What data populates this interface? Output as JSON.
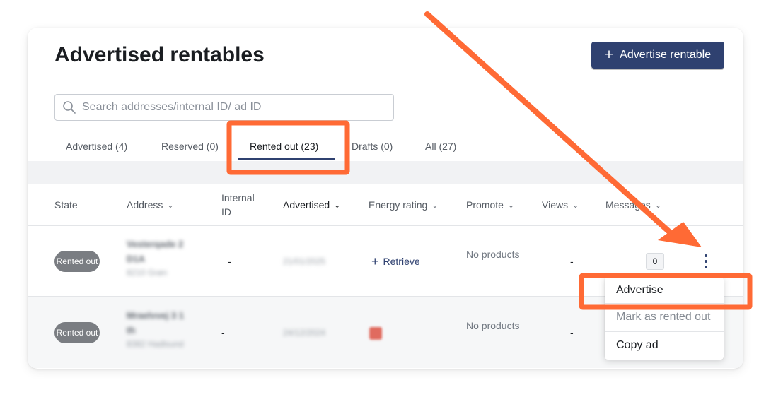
{
  "header": {
    "title": "Advertised rentables",
    "advertise_button": "Advertise rentable"
  },
  "search": {
    "placeholder": "Search addresses/internal ID/ ad ID"
  },
  "tabs": [
    {
      "label": "Advertised (4)",
      "active": false
    },
    {
      "label": "Reserved (0)",
      "active": false
    },
    {
      "label": "Rented out (23)",
      "active": true
    },
    {
      "label": "Drafts (0)",
      "active": false
    },
    {
      "label": "All (27)",
      "active": false
    }
  ],
  "table": {
    "columns": {
      "state": "State",
      "address": "Address",
      "internal_id": "Internal ID",
      "advertised": "Advertised",
      "energy_rating": "Energy rating",
      "promote": "Promote",
      "views": "Views",
      "messages": "Messages"
    },
    "rows": [
      {
        "state": "Rented out",
        "address_line1": "Vesterqade 2",
        "address_line2": "D1A",
        "address_line3": "8210 Grøn",
        "internal_id": "-",
        "advertised": "21/01/2025",
        "energy_action": "Retrieve",
        "promote": "No products",
        "views": "-",
        "messages": "0"
      },
      {
        "state": "Rented out",
        "address_line1": "Mraelvvej 3 1",
        "address_line2": "th",
        "address_line3": "8382 Hadlsund",
        "internal_id": "-",
        "advertised": "24/12/2024",
        "energy_action": "",
        "promote": "No products",
        "views": "-",
        "messages": ""
      }
    ]
  },
  "context_menu": {
    "items": [
      {
        "label": "Advertise",
        "enabled": true
      },
      {
        "label": "Mark as rented out",
        "enabled": false
      },
      {
        "label": "Copy ad",
        "enabled": true
      }
    ]
  },
  "colors": {
    "primary": "#2f4170",
    "annotation": "#ff6a35",
    "pill": "#7a7d82"
  },
  "icons": [
    "plus-icon",
    "search-icon",
    "chevron-down-icon",
    "kebab-icon",
    "arrow-annotation"
  ]
}
